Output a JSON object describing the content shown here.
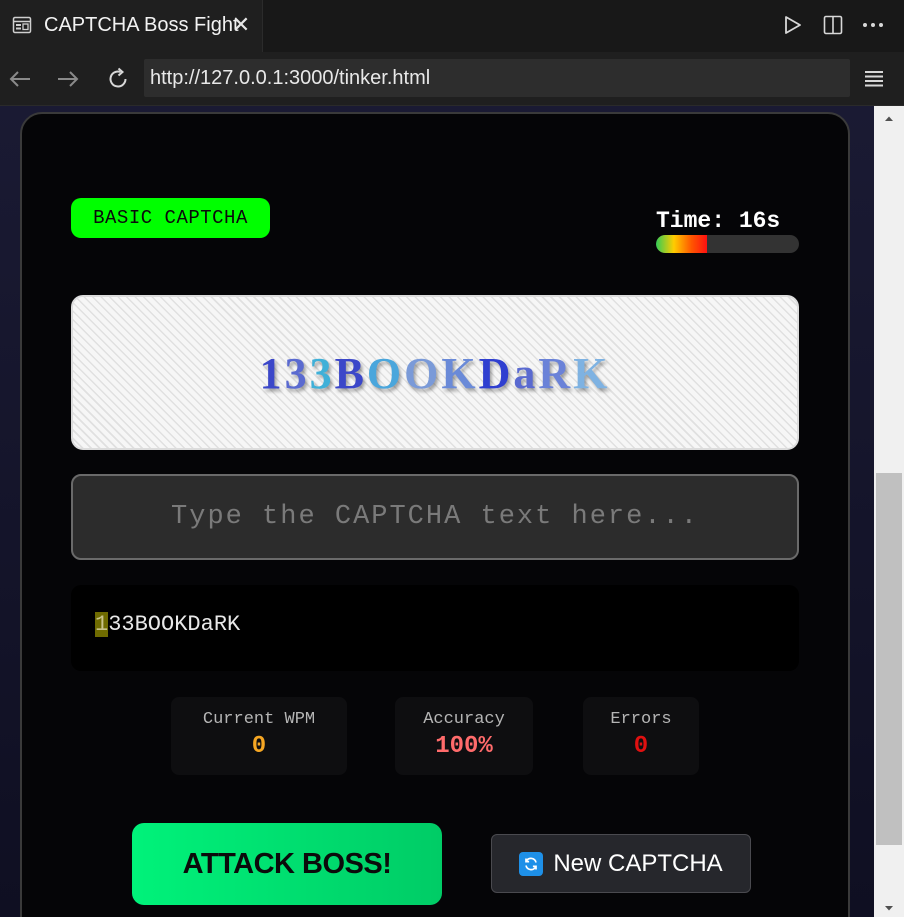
{
  "tab": {
    "title": "CAPTCHA Boss Fight",
    "close": "✕"
  },
  "address": {
    "url": "http://127.0.0.1:3000/tinker.html"
  },
  "game": {
    "badge": "BASIC CAPTCHA",
    "timer_text": "Time: 16s",
    "timer_progress": 0.36,
    "captcha": {
      "text": "133BOOKDaRK",
      "chars": [
        {
          "c": "1",
          "color": "#3b47c9"
        },
        {
          "c": "3",
          "color": "#5a6ad0"
        },
        {
          "c": "3",
          "color": "#3fb0d8"
        },
        {
          "c": "B",
          "color": "#3b47c9"
        },
        {
          "c": "O",
          "color": "#4aa6dc"
        },
        {
          "c": "O",
          "color": "#7a9ad8"
        },
        {
          "c": "K",
          "color": "#6a8ad8"
        },
        {
          "c": "D",
          "color": "#2f3fd0"
        },
        {
          "c": "a",
          "color": "#5a6ad0"
        },
        {
          "c": "R",
          "color": "#6a82d8"
        },
        {
          "c": "K",
          "color": "#7eb2e2"
        }
      ]
    },
    "input": {
      "placeholder": "Type the CAPTCHA text here...",
      "value": ""
    },
    "typed_display": {
      "current": "1",
      "rest": "33BOOKDaRK"
    },
    "stats": [
      {
        "label": "Current WPM",
        "value": "0",
        "color": "#f5a623"
      },
      {
        "label": "Accuracy",
        "value": "100%",
        "color": "#ff6b6b"
      },
      {
        "label": "Errors",
        "value": "0",
        "color": "#e01010"
      }
    ],
    "attack_label": "ATTACK BOSS!",
    "new_captcha_label": "New CAPTCHA"
  },
  "icons": {
    "tab": "browser-page-icon",
    "run": "play-icon",
    "split": "split-editor-icon",
    "more": "more-icon",
    "back": "back-arrow-icon",
    "forward": "forward-arrow-icon",
    "reload": "reload-icon",
    "menu": "menu-icon",
    "refresh": "refresh-icon"
  }
}
